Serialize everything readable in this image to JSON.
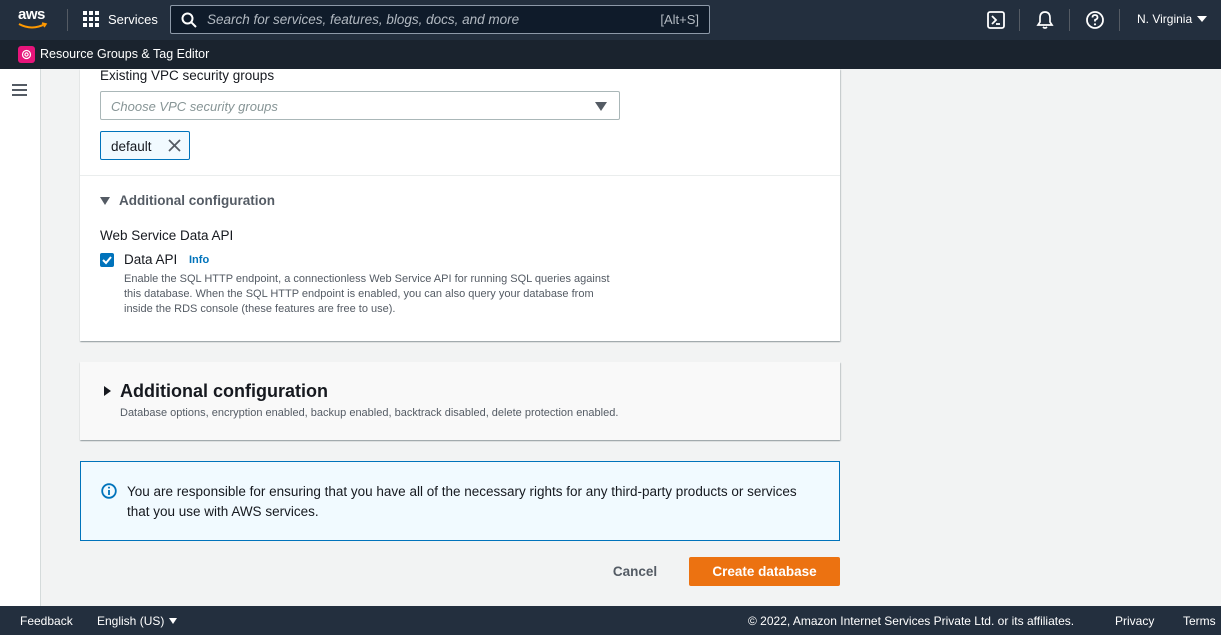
{
  "topnav": {
    "logo_text": "aws",
    "services_label": "Services",
    "search_placeholder": "Search for services, features, blogs, docs, and more",
    "search_shortcut": "[Alt+S]",
    "region": "N. Virginia"
  },
  "subnav": {
    "pinned_service": "Resource Groups & Tag Editor"
  },
  "security_groups": {
    "label": "Existing VPC security groups",
    "placeholder": "Choose VPC security groups",
    "selected": [
      "default"
    ]
  },
  "inner_additional_config": {
    "title": "Additional configuration",
    "section_label": "Web Service Data API",
    "checkbox_label": "Data API",
    "checkbox_checked": true,
    "info_link": "Info",
    "description": "Enable the SQL HTTP endpoint, a connectionless Web Service API for running SQL queries against this database. When the SQL HTTP endpoint is enabled, you can also query your database from inside the RDS console (these features are free to use)."
  },
  "outer_additional_config": {
    "title": "Additional configuration",
    "description": "Database options, encryption enabled, backup enabled, backtrack disabled, delete protection enabled."
  },
  "alert": {
    "text": "You are responsible for ensuring that you have all of the necessary rights for any third-party products or services that you use with AWS services."
  },
  "actions": {
    "cancel": "Cancel",
    "create": "Create database"
  },
  "footer": {
    "feedback": "Feedback",
    "language": "English (US)",
    "copyright": "© 2022, Amazon Internet Services Private Ltd. or its affiliates.",
    "privacy": "Privacy",
    "terms": "Terms"
  },
  "colors": {
    "nav_bg": "#232f3e",
    "primary_button": "#ec7211",
    "link": "#0073bb",
    "resource_groups_icon": "#e7157b"
  }
}
